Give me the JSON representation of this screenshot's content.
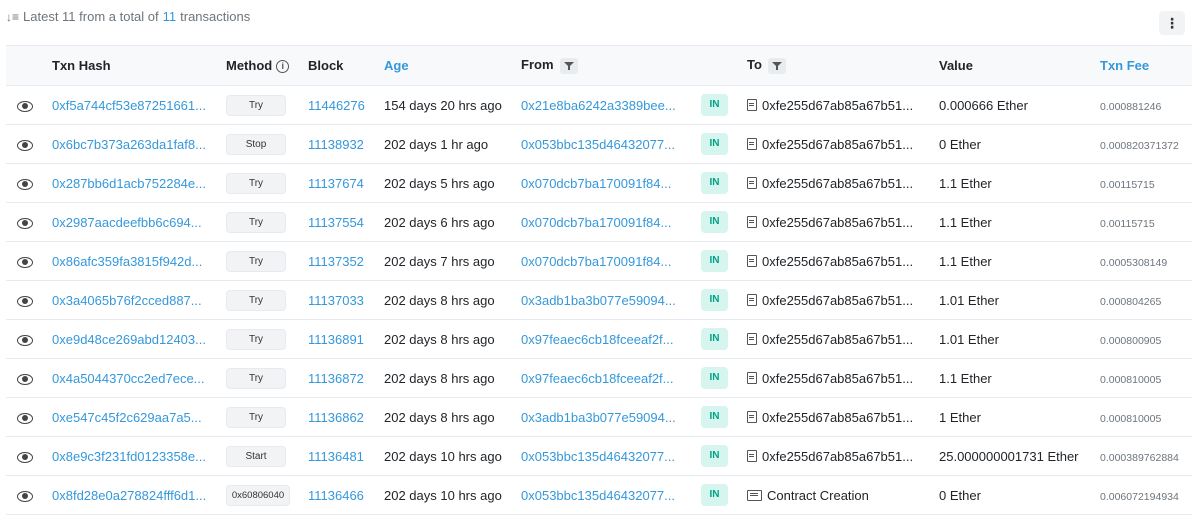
{
  "summary": {
    "prefix": "Latest 11 from a total of",
    "count": "11",
    "suffix": "transactions"
  },
  "columns": {
    "txn_hash": "Txn Hash",
    "method": "Method",
    "block": "Block",
    "age": "Age",
    "from": "From",
    "to": "To",
    "value": "Value",
    "txn_fee": "Txn Fee"
  },
  "rows": [
    {
      "hash": "0xf5a744cf53e87251661...",
      "method": "Try",
      "block": "11446276",
      "age": "154 days 20 hrs ago",
      "from": "0x21e8ba6242a3389bee...",
      "dir": "IN",
      "to": "0xfe255d67ab85a67b51...",
      "value": "0.000666 Ether",
      "fee": "0.000881246"
    },
    {
      "hash": "0x6bc7b373a263da1faf8...",
      "method": "Stop",
      "block": "11138932",
      "age": "202 days 1 hr ago",
      "from": "0x053bbc135d46432077...",
      "dir": "IN",
      "to": "0xfe255d67ab85a67b51...",
      "value": "0 Ether",
      "fee": "0.000820371372"
    },
    {
      "hash": "0x287bb6d1acb752284e...",
      "method": "Try",
      "block": "11137674",
      "age": "202 days 5 hrs ago",
      "from": "0x070dcb7ba170091f84...",
      "dir": "IN",
      "to": "0xfe255d67ab85a67b51...",
      "value": "1.1 Ether",
      "fee": "0.00115715"
    },
    {
      "hash": "0x2987aacdeefbb6c694...",
      "method": "Try",
      "block": "11137554",
      "age": "202 days 6 hrs ago",
      "from": "0x070dcb7ba170091f84...",
      "dir": "IN",
      "to": "0xfe255d67ab85a67b51...",
      "value": "1.1 Ether",
      "fee": "0.00115715"
    },
    {
      "hash": "0x86afc359fa3815f942d...",
      "method": "Try",
      "block": "11137352",
      "age": "202 days 7 hrs ago",
      "from": "0x070dcb7ba170091f84...",
      "dir": "IN",
      "to": "0xfe255d67ab85a67b51...",
      "value": "1.1 Ether",
      "fee": "0.0005308149"
    },
    {
      "hash": "0x3a4065b76f2cced887...",
      "method": "Try",
      "block": "11137033",
      "age": "202 days 8 hrs ago",
      "from": "0x3adb1ba3b077e59094...",
      "dir": "IN",
      "to": "0xfe255d67ab85a67b51...",
      "value": "1.01 Ether",
      "fee": "0.000804265"
    },
    {
      "hash": "0xe9d48ce269abd12403...",
      "method": "Try",
      "block": "11136891",
      "age": "202 days 8 hrs ago",
      "from": "0x97feaec6cb18fceeaf2f...",
      "dir": "IN",
      "to": "0xfe255d67ab85a67b51...",
      "value": "1.01 Ether",
      "fee": "0.000800905"
    },
    {
      "hash": "0x4a5044370cc2ed7ece...",
      "method": "Try",
      "block": "11136872",
      "age": "202 days 8 hrs ago",
      "from": "0x97feaec6cb18fceeaf2f...",
      "dir": "IN",
      "to": "0xfe255d67ab85a67b51...",
      "value": "1.1 Ether",
      "fee": "0.000810005"
    },
    {
      "hash": "0xe547c45f2c629aa7a5...",
      "method": "Try",
      "block": "11136862",
      "age": "202 days 8 hrs ago",
      "from": "0x3adb1ba3b077e59094...",
      "dir": "IN",
      "to": "0xfe255d67ab85a67b51...",
      "value": "1 Ether",
      "fee": "0.000810005"
    },
    {
      "hash": "0x8e9c3f231fd0123358e...",
      "method": "Start",
      "block": "11136481",
      "age": "202 days 10 hrs ago",
      "from": "0x053bbc135d46432077...",
      "dir": "IN",
      "to": "0xfe255d67ab85a67b51...",
      "value": "25.000000001731 Ether",
      "fee": "0.000389762884"
    },
    {
      "hash": "0x8fd28e0a278824fff6d1...",
      "method": "0x60806040",
      "block": "11136466",
      "age": "202 days 10 hrs ago",
      "from": "0x053bbc135d46432077...",
      "dir": "IN",
      "to": "Contract Creation",
      "to_is_creation": true,
      "value": "0 Ether",
      "fee": "0.006072194934"
    }
  ]
}
